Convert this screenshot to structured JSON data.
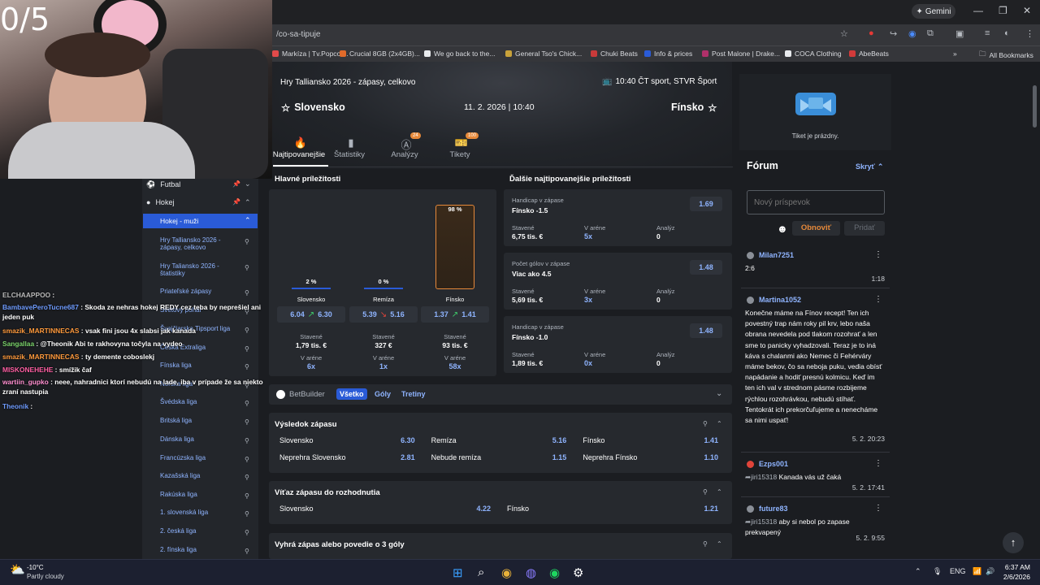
{
  "browser": {
    "gemini_label": "Gemini",
    "url": "/co-sa-tipuje",
    "bookmarks": [
      {
        "label": "Markíza | Tv.Popcor...",
        "color": "#e24a4a"
      },
      {
        "label": "Crucial 8GB (2x4GB)...",
        "color": "#e06a2a"
      },
      {
        "label": "We go back to the...",
        "color": "#e8eaed"
      },
      {
        "label": "General Tso's Chick...",
        "color": "#c9a23a"
      },
      {
        "label": "Chuki Beats",
        "color": "#c93a3a"
      },
      {
        "label": "Info & prices",
        "color": "#2a5bd7"
      },
      {
        "label": "Post Malone | Drake...",
        "color": "#b0306a"
      },
      {
        "label": "COCA Clothing",
        "color": "#e8eaed"
      },
      {
        "label": "AbeBeats",
        "color": "#d23a3a"
      }
    ],
    "all_bookmarks": "All Bookmarks"
  },
  "stream": {
    "counter": "0/5",
    "chat": [
      {
        "user": "ELCHAAPPOO",
        "user_color": "#b9b9b9",
        "text": ""
      },
      {
        "user": "BambavePeroTucne687",
        "user_color": "#6f9cff",
        "text": "Skoda ze nehras hokej REDY cez teba by neprešiel ani jeden puk"
      },
      {
        "user": "smazik_MARTINNECAS",
        "user_color": "#ff9a3c",
        "text": "vsak fini jsou 4x slabsi jak kanada"
      },
      {
        "user": "Sangallaa",
        "user_color": "#7bd36b",
        "text": "@Theonik Abi te rakhovyna točyla na vydeo"
      },
      {
        "user": "smazik_MARTINNECAS",
        "user_color": "#ff9a3c",
        "text": "ty demente coboslekj"
      },
      {
        "user": "MISKONEHEHE",
        "user_color": "#ff5fa3",
        "text": "smížik čaf"
      },
      {
        "user": "wartiin_gupko",
        "user_color": "#ff8fd0",
        "text": "neee, nahradnici ktorí nebudú na lade, iba v prípade že sa niekto zraní nastupia"
      },
      {
        "user": "Theonik",
        "user_color": "#6f9cff",
        "text": ""
      }
    ]
  },
  "sidebar": {
    "sports": [
      {
        "label": "Futbal"
      },
      {
        "label": "Hokej"
      }
    ],
    "group": "Hokej - muži",
    "leagues": [
      "Hry Talliansko 2026 - zápasy, celkovo",
      "Hry Taliansko 2026 - štatistiky",
      "Priateľské zápasy",
      "Svetový pohár ",
      "Švajčiarska Tipsport liga",
      "Česká Extraliga",
      "Fínska liga",
      "Nórska liga",
      "Švédska liga",
      "Britská liga",
      "Dánska liga",
      "Francúzska liga",
      "Kazašská liga",
      "Rakúska liga",
      "1. slovenská liga",
      "2. česká liga",
      "2. fínska liga"
    ]
  },
  "match": {
    "competition": "Hry Talliansko 2026 - zápasy, celkovo",
    "broadcast": "10:40 ČT sport, STVR Šport",
    "home": "Slovensko",
    "away": "Fínsko",
    "datetime": "11. 2. 2026 | 10:40",
    "tabs": [
      {
        "label": "Najtipovanejšie",
        "badge": ""
      },
      {
        "label": "Štatistiky",
        "badge": ""
      },
      {
        "label": "Analýzy",
        "badge": "24"
      },
      {
        "label": "Tikety",
        "badge": "100"
      }
    ]
  },
  "main_opportunities": {
    "title": "Hlavné príležitosti",
    "columns": [
      {
        "name": "Slovensko",
        "pct": 2,
        "pct_label": "2 %",
        "odds_from": "6.04",
        "odds_to": "6.30",
        "trend": "up",
        "staked_label": "Stavené",
        "staked": "1,79 tis. €",
        "arena_label": "V aréne",
        "arena": "6x"
      },
      {
        "name": "Remíza",
        "pct": 0,
        "pct_label": "0 %",
        "odds_from": "5.39",
        "odds_to": "5.16",
        "trend": "down",
        "staked_label": "Stavené",
        "staked": "327 €",
        "arena_label": "V aréne",
        "arena": "1x"
      },
      {
        "name": "Fínsko",
        "pct": 98,
        "pct_label": "98 %",
        "odds_from": "1.37",
        "odds_to": "1.41",
        "trend": "up",
        "staked_label": "Stavené",
        "staked": "93 tis. €",
        "arena_label": "V aréne",
        "arena": "58x"
      }
    ]
  },
  "other_opportunities": {
    "title": "Ďalšie najtipovanejšie príležitosti",
    "items": [
      {
        "market": "Handicap v zápase",
        "pick": "Fínsko -1.5",
        "odd": "1.69",
        "staked_label": "Stavené",
        "staked": "6,75 tis. €",
        "arena_label": "V aréne",
        "arena": "5x",
        "an_label": "Analýz",
        "analyses": "0"
      },
      {
        "market": "Počet gólov v zápase",
        "pick": "Viac ako 4.5",
        "odd": "1.48",
        "staked_label": "Stavené",
        "staked": "5,69 tis. €",
        "arena_label": "V aréne",
        "arena": "3x",
        "an_label": "Analýz",
        "analyses": "0"
      },
      {
        "market": "Handicap v zápase",
        "pick": "Fínsko -1.0",
        "odd": "1.48",
        "staked_label": "Stavené",
        "staked": "1,89 tis. €",
        "arena_label": "V aréne",
        "arena": "0x",
        "an_label": "Analýz",
        "analyses": "0"
      }
    ]
  },
  "filters": {
    "betbuilder": "BetBuilder",
    "chips": [
      "Všetko",
      "Góly",
      "Tretiny"
    ]
  },
  "markets": [
    {
      "title": "Výsledok zápasu",
      "rows": [
        [
          {
            "label": "Slovensko",
            "odd": "6.30"
          },
          {
            "label": "Remíza",
            "odd": "5.16"
          },
          {
            "label": "Fínsko",
            "odd": "1.41"
          }
        ],
        [
          {
            "label": "Neprehra Slovensko",
            "odd": "2.81"
          },
          {
            "label": "Nebude remíza",
            "odd": "1.15"
          },
          {
            "label": "Neprehra Fínsko",
            "odd": "1.10"
          }
        ]
      ]
    },
    {
      "title": "Víťaz zápasu do rozhodnutia",
      "rows": [
        [
          {
            "label": "Slovensko",
            "odd": "4.22"
          },
          {
            "label": "Fínsko",
            "odd": "1.21"
          }
        ]
      ]
    },
    {
      "title": "Vyhrá zápas alebo povedie o 3 góly",
      "rows": []
    }
  ],
  "ticket": {
    "empty": "Tiket je prázdny."
  },
  "forum": {
    "title": "Fórum",
    "hide": "Skryť",
    "placeholder": "Nový príspevok",
    "refresh": "Obnoviť",
    "add": "Pridať",
    "posts": [
      {
        "user": "Milan7251",
        "reply": "",
        "text": "2:6",
        "date": "1:18"
      },
      {
        "user": "Martina1052",
        "reply": "",
        "text": "Konečne máme na Fínov recept! Ten ich povestný trap nám roky pil krv, lebo naša obrana nevedela pod tlakom rozohrať a len sme to panicky vyhadzovali. Teraz je to iná káva s chalanmi ako Nemec či Fehérváry máme bekov, čo sa neboja puku, vedia obísť napádanie a hodiť presnú kolmicu. Keď im ten ich val v strednom pásme rozbijeme rýchlou rozohrávkou, nebudú stíhať. Tentokrát ich prekorčuľujeme a nenecháme sa nimi uspať!",
        "date": "5. 2. 20:23"
      },
      {
        "user": "Ezps001",
        "reply": "jiri15318",
        "text": "Kanada vás už čaká",
        "date": "5. 2. 17:41"
      },
      {
        "user": "future83",
        "reply": "jiri15318",
        "text": "aby si nebol po zapase prekvapený",
        "date": "5. 2. 9:55"
      }
    ]
  },
  "taskbar": {
    "weather_temp": "-10°C",
    "weather_desc": "Partly cloudy",
    "lang": "ENG",
    "time": "6:37 AM",
    "date": "2/6/2026"
  },
  "colors": {
    "accent": "#e6893a",
    "link": "#8fb4ff",
    "active_tab": "#2a5bd7"
  }
}
